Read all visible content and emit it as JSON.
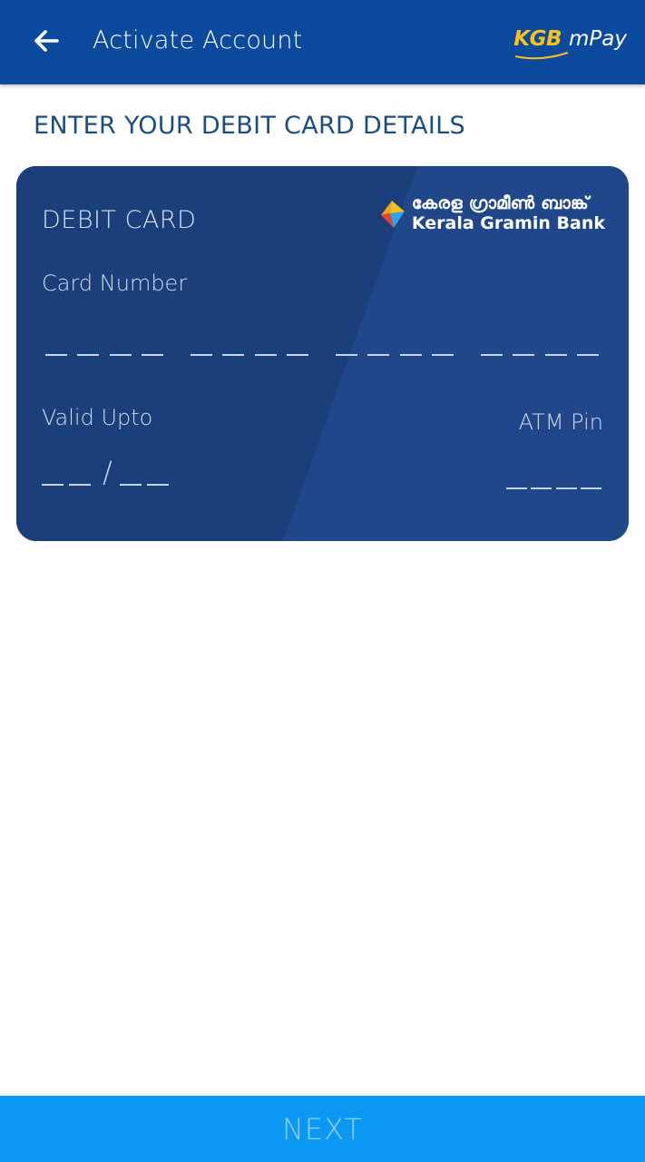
{
  "appbar": {
    "title": "Activate Account",
    "brand_primary": "KGB",
    "brand_secondary": "mPay",
    "back_icon": "arrow-left-icon",
    "background_color": "#0b4a9c"
  },
  "heading": "ENTER YOUR DEBIT CARD DETAILS",
  "card": {
    "type_label": "DEBIT CARD",
    "bank_name_malayalam": "കേരള ഗ്രാമീൺ ബാങ്ക്",
    "bank_name": "Kerala Gramin Bank",
    "card_number_label": "Card Number",
    "valid_upto_label": "Valid Upto",
    "expiry_separator": "/",
    "atm_pin_label": "ATM Pin",
    "card_color": "#1e4688"
  },
  "footer": {
    "next_label": "NEXT",
    "button_color": "#0a98f2"
  }
}
